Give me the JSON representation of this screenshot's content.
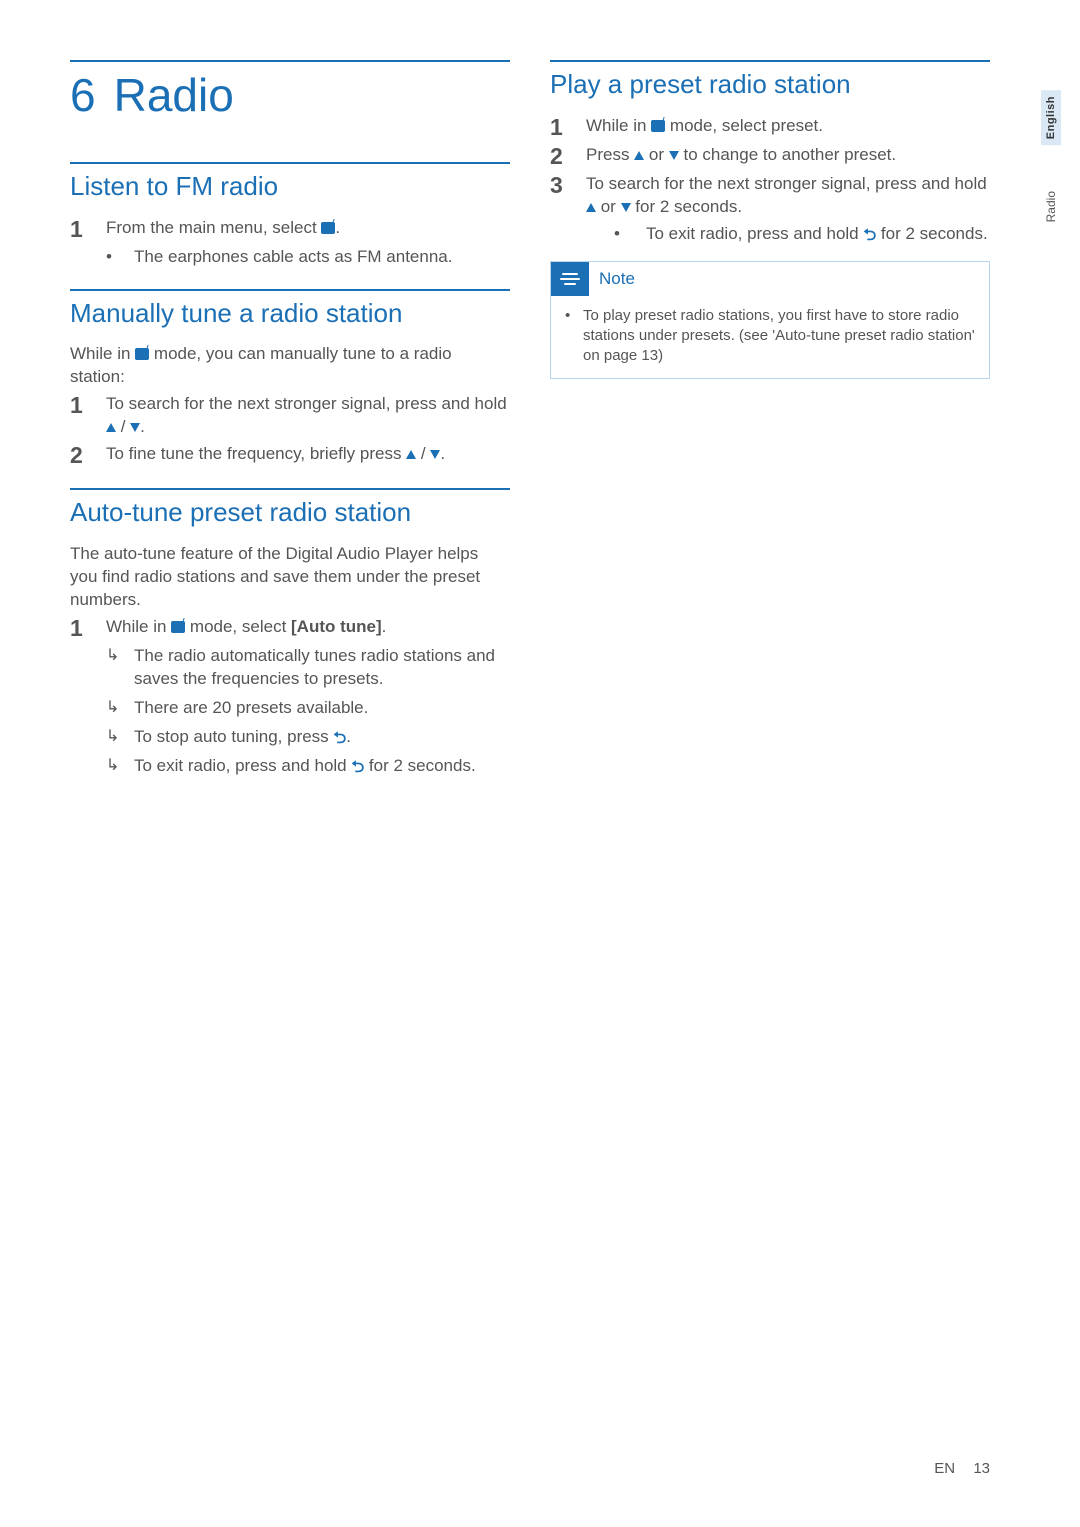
{
  "chapter": {
    "num": "6",
    "title": "Radio"
  },
  "sections": {
    "listen": {
      "title": "Listen to FM radio",
      "step1_pre": "From the main menu, select ",
      "step1_post": ".",
      "bullet1": "The earphones cable acts as FM antenna."
    },
    "manual": {
      "title": "Manually tune a radio station",
      "intro_pre": "While in ",
      "intro_post": " mode, you can manually tune to a radio station:",
      "step1_pre": "To search for the next stronger signal, press and hold ",
      "step1_sep": " / ",
      "step1_post": ".",
      "step2_pre": "To fine tune the frequency, briefly press ",
      "step2_sep": " / ",
      "step2_post": "."
    },
    "auto": {
      "title": "Auto-tune preset radio station",
      "intro": "The auto-tune feature of the Digital Audio Player helps you find radio stations and save them under the preset numbers.",
      "step1_pre": "While in ",
      "step1_mid": " mode, select ",
      "step1_bold": "[Auto tune]",
      "step1_post": ".",
      "res1": "The radio automatically tunes radio stations and saves the frequencies to presets.",
      "res2": "There are 20 presets available.",
      "res3_pre": "To stop auto tuning, press ",
      "res3_post": ".",
      "res4_pre": "To exit radio, press and hold ",
      "res4_post": " for 2 seconds."
    },
    "play": {
      "title": "Play a preset radio station",
      "step1_pre": "While in ",
      "step1_post": " mode, select preset.",
      "step2_pre": "Press ",
      "step2_mid": " or ",
      "step2_post": " to change to another preset.",
      "step3_pre": "To search for the next stronger signal, press and hold ",
      "step3_mid": " or ",
      "step3_post": " for 2 seconds.",
      "sub1_pre": "To exit radio, press and hold ",
      "sub1_post": " for 2 seconds."
    },
    "note": {
      "label": "Note",
      "body": "To play preset radio stations, you first have to store radio stations under presets. (see 'Auto-tune preset radio station' on page 13)"
    }
  },
  "nums": {
    "n1": "1",
    "n2": "2",
    "n3": "3"
  },
  "tabs": {
    "lang": "English",
    "section": "Radio"
  },
  "footer": {
    "lang": "EN",
    "page": "13"
  }
}
